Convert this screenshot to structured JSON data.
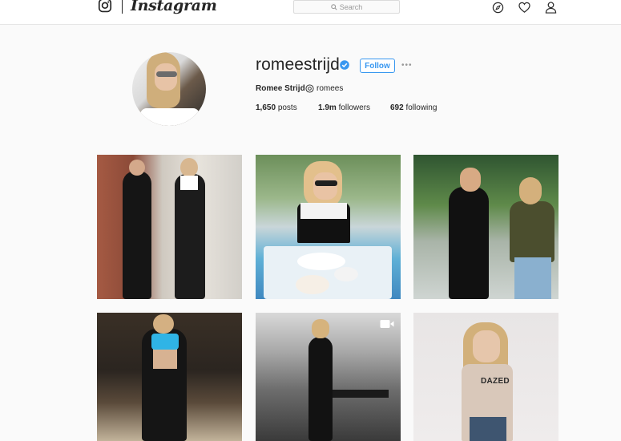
{
  "topnav": {
    "brand": "Instagram",
    "search_placeholder": "Search"
  },
  "profile": {
    "username": "romeestrijd",
    "verified": true,
    "follow_label": "Follow",
    "more_label": "•••",
    "full_name": "Romee Strijd",
    "handle": "romees",
    "stats": {
      "posts_count": "1,650",
      "posts_label": "posts",
      "followers_count": "1.9m",
      "followers_label": "followers",
      "following_count": "692",
      "following_label": "following"
    }
  },
  "grid": {
    "post6_shirt_text": "DAZED"
  }
}
